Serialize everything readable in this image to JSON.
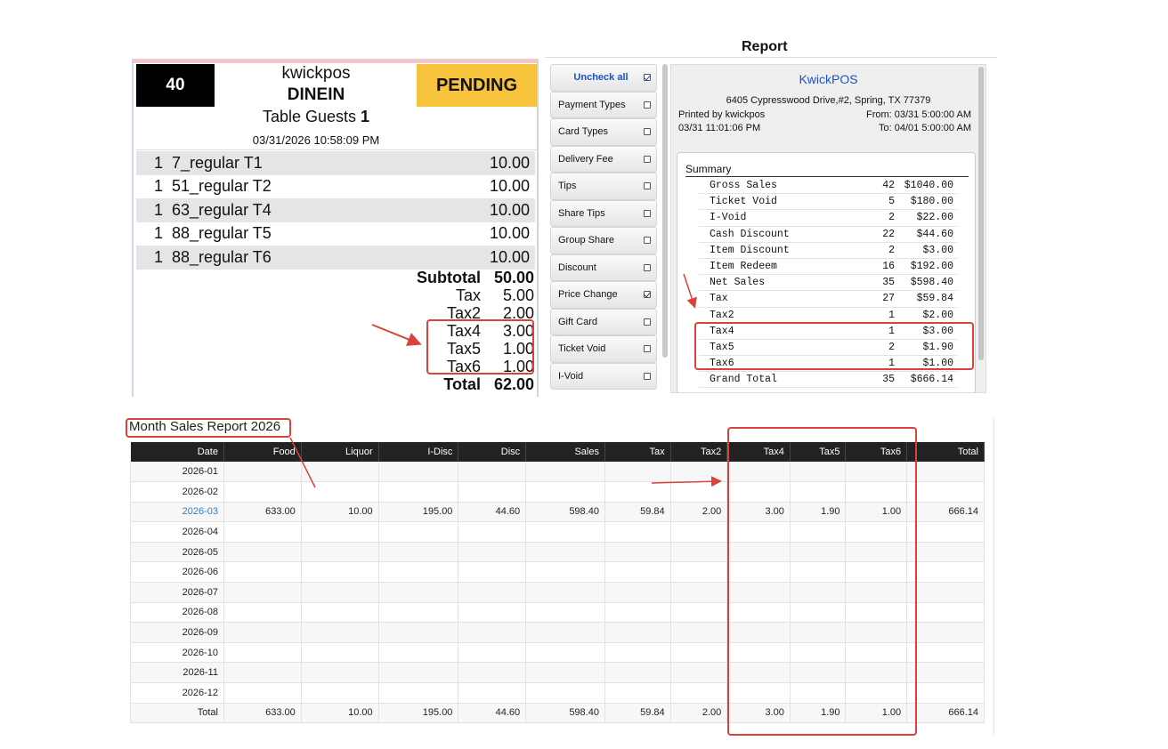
{
  "receipt": {
    "number": "40",
    "store": "kwickpos",
    "order_type": "DINEIN",
    "status": "PENDING",
    "guests_label": "Table Guests",
    "guests_count": "1",
    "datetime": "03/31/2026 10:58:09 PM",
    "items": [
      {
        "qty": "1",
        "name": "7_regular T1",
        "price": "10.00"
      },
      {
        "qty": "1",
        "name": "51_regular T2",
        "price": "10.00"
      },
      {
        "qty": "1",
        "name": "63_regular T4",
        "price": "10.00"
      },
      {
        "qty": "1",
        "name": "88_regular T5",
        "price": "10.00"
      },
      {
        "qty": "1",
        "name": "88_regular T6",
        "price": "10.00"
      }
    ],
    "totals": [
      {
        "label": "Subtotal",
        "value": "50.00",
        "bold": true
      },
      {
        "label": "Tax",
        "value": "5.00",
        "bold": false
      },
      {
        "label": "Tax2",
        "value": "2.00",
        "bold": false
      },
      {
        "label": "Tax4",
        "value": "3.00",
        "bold": false
      },
      {
        "label": "Tax5",
        "value": "1.00",
        "bold": false
      },
      {
        "label": "Tax6",
        "value": "1.00",
        "bold": false
      },
      {
        "label": "Total",
        "value": "62.00",
        "bold": true
      }
    ]
  },
  "report": {
    "title": "Report",
    "filters": [
      {
        "label": "Uncheck all",
        "checked": true
      },
      {
        "label": "Payment Types",
        "checked": false
      },
      {
        "label": "Card Types",
        "checked": false
      },
      {
        "label": "Delivery Fee",
        "checked": false
      },
      {
        "label": "Tips",
        "checked": false
      },
      {
        "label": "Share Tips",
        "checked": false
      },
      {
        "label": "Group Share",
        "checked": false
      },
      {
        "label": "Discount",
        "checked": false
      },
      {
        "label": "Price Change",
        "checked": true
      },
      {
        "label": "Gift Card",
        "checked": false
      },
      {
        "label": "Ticket Void",
        "checked": false
      },
      {
        "label": "I-Void",
        "checked": false
      }
    ],
    "company": "KwickPOS",
    "address": "6405 Cypresswood Drive,#2, Spring, TX 77379",
    "printed_by": "Printed by kwickpos",
    "printed_time": "03/31 11:01:06 PM",
    "from": "From: 03/31 5:00:00 AM",
    "to": "To: 04/01 5:00:00 AM",
    "summary_title": "Summary",
    "summary_rows": [
      {
        "name": "Gross Sales",
        "count": "42",
        "amount": "$1040.00"
      },
      {
        "name": "Ticket Void",
        "count": "5",
        "amount": "$180.00"
      },
      {
        "name": "I-Void",
        "count": "2",
        "amount": "$22.00"
      },
      {
        "name": "Cash Discount",
        "count": "22",
        "amount": "$44.60"
      },
      {
        "name": "Item Discount",
        "count": "2",
        "amount": "$3.00"
      },
      {
        "name": "Item Redeem",
        "count": "16",
        "amount": "$192.00"
      },
      {
        "name": "Net Sales",
        "count": "35",
        "amount": "$598.40"
      },
      {
        "name": "Tax",
        "count": "27",
        "amount": "$59.84"
      },
      {
        "name": "Tax2",
        "count": "1",
        "amount": "$2.00"
      },
      {
        "name": "Tax4",
        "count": "1",
        "amount": "$3.00"
      },
      {
        "name": "Tax5",
        "count": "2",
        "amount": "$1.90"
      },
      {
        "name": "Tax6",
        "count": "1",
        "amount": "$1.00"
      },
      {
        "name": "Grand Total",
        "count": "35",
        "amount": "$666.14"
      }
    ]
  },
  "month_report": {
    "title": "Month Sales Report 2026",
    "columns": [
      "Date",
      "Food",
      "Liquor",
      "I-Disc",
      "Disc",
      "Sales",
      "Tax",
      "Tax2",
      "Tax4",
      "Tax5",
      "Tax6",
      "Total"
    ],
    "rows": [
      [
        "2026-01",
        "",
        "",
        "",
        "",
        "",
        "",
        "",
        "",
        "",
        "",
        ""
      ],
      [
        "2026-02",
        "",
        "",
        "",
        "",
        "",
        "",
        "",
        "",
        "",
        "",
        ""
      ],
      [
        "2026-03",
        "633.00",
        "10.00",
        "195.00",
        "44.60",
        "598.40",
        "59.84",
        "2.00",
        "3.00",
        "1.90",
        "1.00",
        "666.14"
      ],
      [
        "2026-04",
        "",
        "",
        "",
        "",
        "",
        "",
        "",
        "",
        "",
        "",
        ""
      ],
      [
        "2026-05",
        "",
        "",
        "",
        "",
        "",
        "",
        "",
        "",
        "",
        "",
        ""
      ],
      [
        "2026-06",
        "",
        "",
        "",
        "",
        "",
        "",
        "",
        "",
        "",
        "",
        ""
      ],
      [
        "2026-07",
        "",
        "",
        "",
        "",
        "",
        "",
        "",
        "",
        "",
        "",
        ""
      ],
      [
        "2026-08",
        "",
        "",
        "",
        "",
        "",
        "",
        "",
        "",
        "",
        "",
        ""
      ],
      [
        "2026-09",
        "",
        "",
        "",
        "",
        "",
        "",
        "",
        "",
        "",
        "",
        ""
      ],
      [
        "2026-10",
        "",
        "",
        "",
        "",
        "",
        "",
        "",
        "",
        "",
        "",
        ""
      ],
      [
        "2026-11",
        "",
        "",
        "",
        "",
        "",
        "",
        "",
        "",
        "",
        "",
        ""
      ],
      [
        "2026-12",
        "",
        "",
        "",
        "",
        "",
        "",
        "",
        "",
        "",
        "",
        ""
      ],
      [
        "Total",
        "633.00",
        "10.00",
        "195.00",
        "44.60",
        "598.40",
        "59.84",
        "2.00",
        "3.00",
        "1.90",
        "1.00",
        "666.14"
      ]
    ],
    "linked_row": "2026-03"
  },
  "colors": {
    "annotation": "#d9433b",
    "pending": "#f7c33c",
    "link": "#2a7fd4",
    "company": "#1a53c5"
  }
}
